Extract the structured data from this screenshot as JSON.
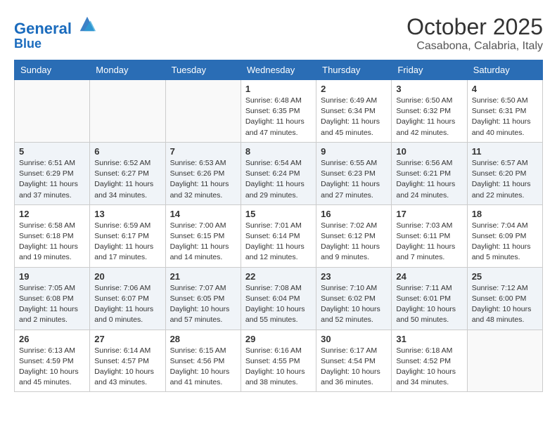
{
  "header": {
    "logo_line1": "General",
    "logo_line2": "Blue",
    "month": "October 2025",
    "location": "Casabona, Calabria, Italy"
  },
  "weekdays": [
    "Sunday",
    "Monday",
    "Tuesday",
    "Wednesday",
    "Thursday",
    "Friday",
    "Saturday"
  ],
  "weeks": [
    [
      {
        "day": "",
        "info": ""
      },
      {
        "day": "",
        "info": ""
      },
      {
        "day": "",
        "info": ""
      },
      {
        "day": "1",
        "info": "Sunrise: 6:48 AM\nSunset: 6:35 PM\nDaylight: 11 hours\nand 47 minutes."
      },
      {
        "day": "2",
        "info": "Sunrise: 6:49 AM\nSunset: 6:34 PM\nDaylight: 11 hours\nand 45 minutes."
      },
      {
        "day": "3",
        "info": "Sunrise: 6:50 AM\nSunset: 6:32 PM\nDaylight: 11 hours\nand 42 minutes."
      },
      {
        "day": "4",
        "info": "Sunrise: 6:50 AM\nSunset: 6:31 PM\nDaylight: 11 hours\nand 40 minutes."
      }
    ],
    [
      {
        "day": "5",
        "info": "Sunrise: 6:51 AM\nSunset: 6:29 PM\nDaylight: 11 hours\nand 37 minutes."
      },
      {
        "day": "6",
        "info": "Sunrise: 6:52 AM\nSunset: 6:27 PM\nDaylight: 11 hours\nand 34 minutes."
      },
      {
        "day": "7",
        "info": "Sunrise: 6:53 AM\nSunset: 6:26 PM\nDaylight: 11 hours\nand 32 minutes."
      },
      {
        "day": "8",
        "info": "Sunrise: 6:54 AM\nSunset: 6:24 PM\nDaylight: 11 hours\nand 29 minutes."
      },
      {
        "day": "9",
        "info": "Sunrise: 6:55 AM\nSunset: 6:23 PM\nDaylight: 11 hours\nand 27 minutes."
      },
      {
        "day": "10",
        "info": "Sunrise: 6:56 AM\nSunset: 6:21 PM\nDaylight: 11 hours\nand 24 minutes."
      },
      {
        "day": "11",
        "info": "Sunrise: 6:57 AM\nSunset: 6:20 PM\nDaylight: 11 hours\nand 22 minutes."
      }
    ],
    [
      {
        "day": "12",
        "info": "Sunrise: 6:58 AM\nSunset: 6:18 PM\nDaylight: 11 hours\nand 19 minutes."
      },
      {
        "day": "13",
        "info": "Sunrise: 6:59 AM\nSunset: 6:17 PM\nDaylight: 11 hours\nand 17 minutes."
      },
      {
        "day": "14",
        "info": "Sunrise: 7:00 AM\nSunset: 6:15 PM\nDaylight: 11 hours\nand 14 minutes."
      },
      {
        "day": "15",
        "info": "Sunrise: 7:01 AM\nSunset: 6:14 PM\nDaylight: 11 hours\nand 12 minutes."
      },
      {
        "day": "16",
        "info": "Sunrise: 7:02 AM\nSunset: 6:12 PM\nDaylight: 11 hours\nand 9 minutes."
      },
      {
        "day": "17",
        "info": "Sunrise: 7:03 AM\nSunset: 6:11 PM\nDaylight: 11 hours\nand 7 minutes."
      },
      {
        "day": "18",
        "info": "Sunrise: 7:04 AM\nSunset: 6:09 PM\nDaylight: 11 hours\nand 5 minutes."
      }
    ],
    [
      {
        "day": "19",
        "info": "Sunrise: 7:05 AM\nSunset: 6:08 PM\nDaylight: 11 hours\nand 2 minutes."
      },
      {
        "day": "20",
        "info": "Sunrise: 7:06 AM\nSunset: 6:07 PM\nDaylight: 11 hours\nand 0 minutes."
      },
      {
        "day": "21",
        "info": "Sunrise: 7:07 AM\nSunset: 6:05 PM\nDaylight: 10 hours\nand 57 minutes."
      },
      {
        "day": "22",
        "info": "Sunrise: 7:08 AM\nSunset: 6:04 PM\nDaylight: 10 hours\nand 55 minutes."
      },
      {
        "day": "23",
        "info": "Sunrise: 7:10 AM\nSunset: 6:02 PM\nDaylight: 10 hours\nand 52 minutes."
      },
      {
        "day": "24",
        "info": "Sunrise: 7:11 AM\nSunset: 6:01 PM\nDaylight: 10 hours\nand 50 minutes."
      },
      {
        "day": "25",
        "info": "Sunrise: 7:12 AM\nSunset: 6:00 PM\nDaylight: 10 hours\nand 48 minutes."
      }
    ],
    [
      {
        "day": "26",
        "info": "Sunrise: 6:13 AM\nSunset: 4:59 PM\nDaylight: 10 hours\nand 45 minutes."
      },
      {
        "day": "27",
        "info": "Sunrise: 6:14 AM\nSunset: 4:57 PM\nDaylight: 10 hours\nand 43 minutes."
      },
      {
        "day": "28",
        "info": "Sunrise: 6:15 AM\nSunset: 4:56 PM\nDaylight: 10 hours\nand 41 minutes."
      },
      {
        "day": "29",
        "info": "Sunrise: 6:16 AM\nSunset: 4:55 PM\nDaylight: 10 hours\nand 38 minutes."
      },
      {
        "day": "30",
        "info": "Sunrise: 6:17 AM\nSunset: 4:54 PM\nDaylight: 10 hours\nand 36 minutes."
      },
      {
        "day": "31",
        "info": "Sunrise: 6:18 AM\nSunset: 4:52 PM\nDaylight: 10 hours\nand 34 minutes."
      },
      {
        "day": "",
        "info": ""
      }
    ]
  ]
}
